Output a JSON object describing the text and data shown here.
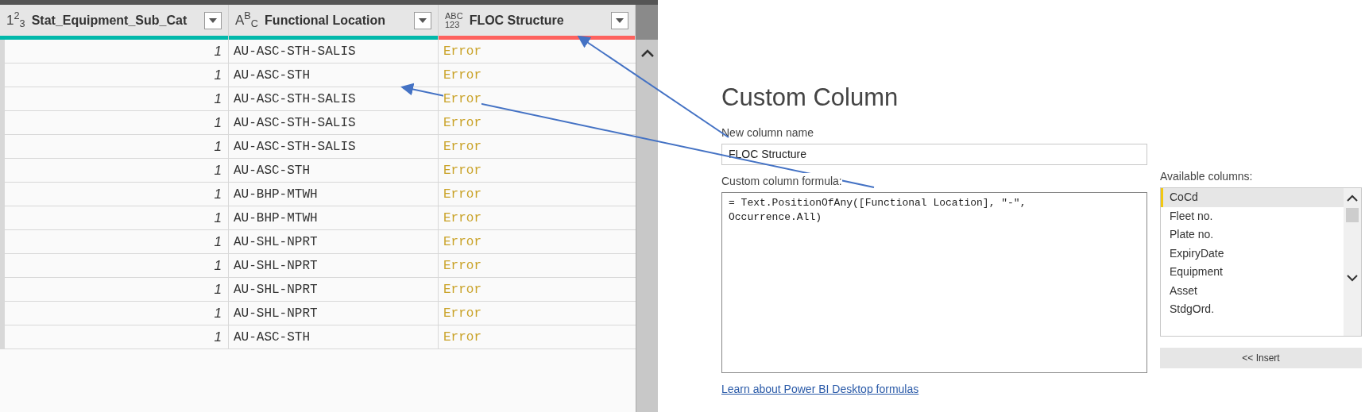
{
  "table": {
    "columns": [
      {
        "type_icon": [
          "1$^{2}$$_{3}$"
        ],
        "label": "Stat_Equipment_Sub_Cat",
        "color": "#01b8aa"
      },
      {
        "type_icon": [
          "A$^{B}$$_{C}$"
        ],
        "label": "Functional Location",
        "color": "#01b8aa"
      },
      {
        "type_icon": [
          "ABC",
          "123"
        ],
        "label": "FLOC Structure",
        "color": "#fd625e"
      }
    ],
    "rows": [
      [
        "1",
        "AU-ASC-STH-SALIS",
        "Error"
      ],
      [
        "1",
        "AU-ASC-STH",
        "Error"
      ],
      [
        "1",
        "AU-ASC-STH-SALIS",
        "Error"
      ],
      [
        "1",
        "AU-ASC-STH-SALIS",
        "Error"
      ],
      [
        "1",
        "AU-ASC-STH-SALIS",
        "Error"
      ],
      [
        "1",
        "AU-ASC-STH",
        "Error"
      ],
      [
        "1",
        "AU-BHP-MTWH",
        "Error"
      ],
      [
        "1",
        "AU-BHP-MTWH",
        "Error"
      ],
      [
        "1",
        "AU-SHL-NPRT",
        "Error"
      ],
      [
        "1",
        "AU-SHL-NPRT",
        "Error"
      ],
      [
        "1",
        "AU-SHL-NPRT",
        "Error"
      ],
      [
        "1",
        "AU-SHL-NPRT",
        "Error"
      ],
      [
        "1",
        "AU-ASC-STH",
        "Error"
      ]
    ]
  },
  "dialog": {
    "title": "Custom Column",
    "name_label": "New column name",
    "name_value": "FLOC Structure",
    "formula_label": "Custom column formula:",
    "formula_lines": [
      "= Text.PositionOfAny([Functional Location], \"-\",",
      "Occurrence.All)"
    ],
    "available_label": "Available columns:",
    "available_columns": [
      {
        "label": "CoCd",
        "selected": true
      },
      {
        "label": "Fleet no.",
        "selected": false
      },
      {
        "label": "Plate no.",
        "selected": false
      },
      {
        "label": "ExpiryDate",
        "selected": false
      },
      {
        "label": "Equipment",
        "selected": false
      },
      {
        "label": "Asset",
        "selected": false
      },
      {
        "label": "StdgOrd.",
        "selected": false
      }
    ],
    "insert_button": "<< Insert",
    "link": "Learn about Power BI Desktop formulas"
  }
}
